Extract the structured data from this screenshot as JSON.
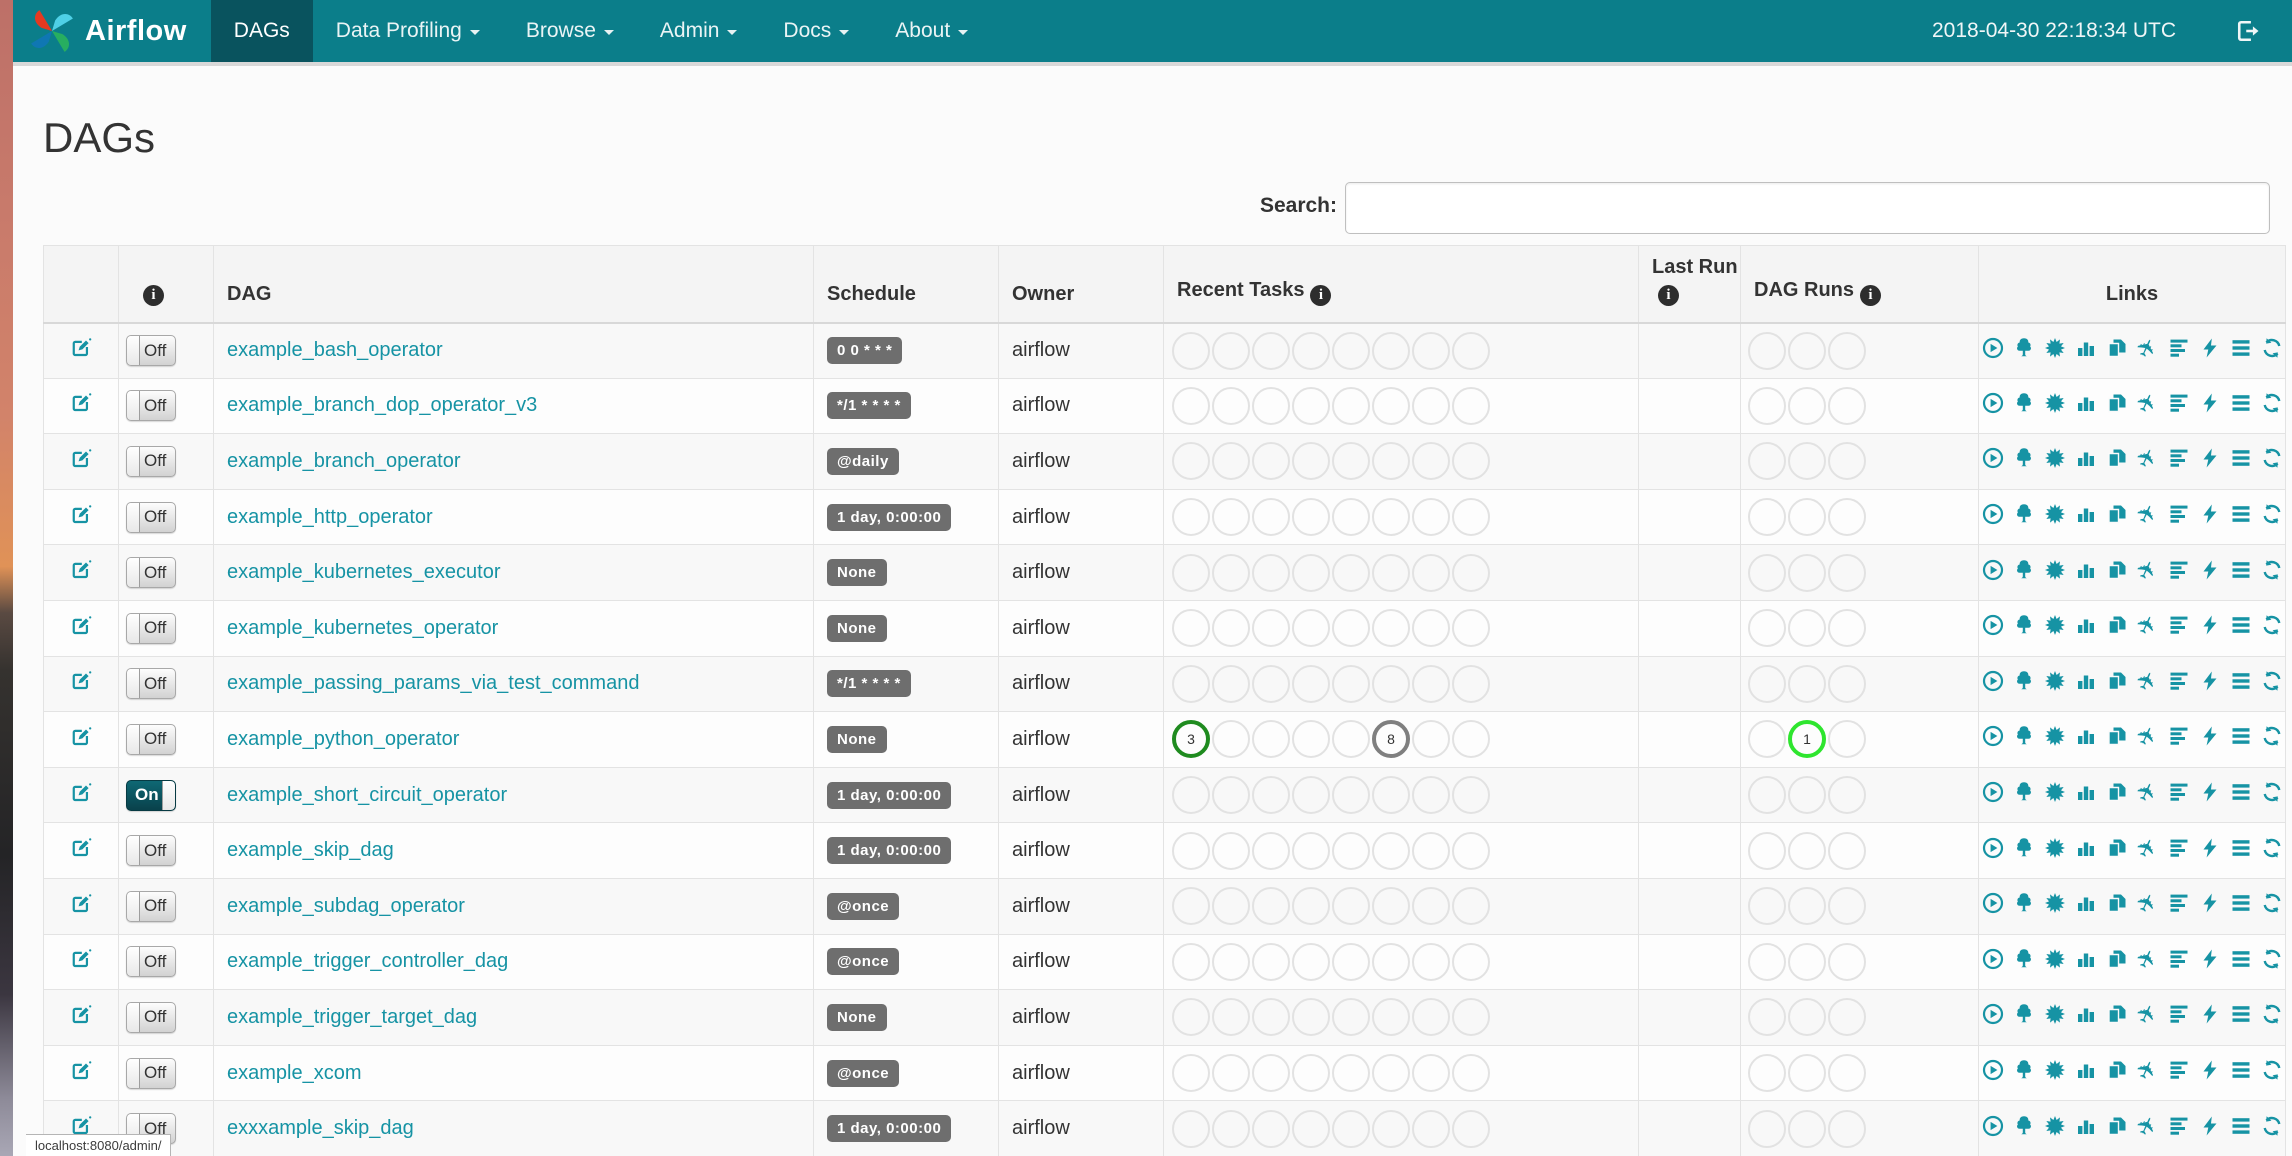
{
  "navbar": {
    "brand": "Airflow",
    "items": [
      {
        "label": "DAGs",
        "active": true,
        "caret": false
      },
      {
        "label": "Data Profiling",
        "active": false,
        "caret": true
      },
      {
        "label": "Browse",
        "active": false,
        "caret": true
      },
      {
        "label": "Admin",
        "active": false,
        "caret": true
      },
      {
        "label": "Docs",
        "active": false,
        "caret": true
      },
      {
        "label": "About",
        "active": false,
        "caret": true
      }
    ],
    "clock": "2018-04-30 22:18:34 UTC",
    "logout_icon": "sign-out-icon"
  },
  "page": {
    "title": "DAGs",
    "search_label": "Search:",
    "search_value": ""
  },
  "table": {
    "headers": {
      "edit": "",
      "info_icon": "info-icon",
      "dag": "DAG",
      "schedule": "Schedule",
      "owner": "Owner",
      "recent_tasks": "Recent Tasks",
      "last_run": "Last Run",
      "dag_runs": "DAG Runs",
      "links": "Links"
    },
    "recent_task_slots": 8,
    "dag_run_slots": 3,
    "links_icons": [
      "trigger-dag-icon",
      "tree-view-icon",
      "graph-view-icon",
      "task-duration-icon",
      "task-tries-icon",
      "landing-times-icon",
      "gantt-icon",
      "code-view-icon",
      "logs-icon",
      "refresh-icon"
    ],
    "rows": [
      {
        "name": "example_bash_operator",
        "toggle": "Off",
        "schedule": "0 0 * * *",
        "owner": "airflow",
        "recent_tasks": [],
        "dag_runs": []
      },
      {
        "name": "example_branch_dop_operator_v3",
        "toggle": "Off",
        "schedule": "*/1 * * * *",
        "owner": "airflow",
        "recent_tasks": [],
        "dag_runs": []
      },
      {
        "name": "example_branch_operator",
        "toggle": "Off",
        "schedule": "@daily",
        "owner": "airflow",
        "recent_tasks": [],
        "dag_runs": []
      },
      {
        "name": "example_http_operator",
        "toggle": "Off",
        "schedule": "1 day, 0:00:00",
        "owner": "airflow",
        "recent_tasks": [],
        "dag_runs": []
      },
      {
        "name": "example_kubernetes_executor",
        "toggle": "Off",
        "schedule": "None",
        "owner": "airflow",
        "recent_tasks": [],
        "dag_runs": []
      },
      {
        "name": "example_kubernetes_operator",
        "toggle": "Off",
        "schedule": "None",
        "owner": "airflow",
        "recent_tasks": [],
        "dag_runs": []
      },
      {
        "name": "example_passing_params_via_test_command",
        "toggle": "Off",
        "schedule": "*/1 * * * *",
        "owner": "airflow",
        "recent_tasks": [],
        "dag_runs": []
      },
      {
        "name": "example_python_operator",
        "toggle": "Off",
        "schedule": "None",
        "owner": "airflow",
        "recent_tasks": [
          {
            "slot": 1,
            "count": 3,
            "state": "success"
          },
          {
            "slot": 6,
            "count": 8,
            "state": "queued"
          }
        ],
        "dag_runs": [
          {
            "slot": 2,
            "count": 1,
            "state": "running"
          }
        ]
      },
      {
        "name": "example_short_circuit_operator",
        "toggle": "On",
        "schedule": "1 day, 0:00:00",
        "owner": "airflow",
        "recent_tasks": [],
        "dag_runs": []
      },
      {
        "name": "example_skip_dag",
        "toggle": "Off",
        "schedule": "1 day, 0:00:00",
        "owner": "airflow",
        "recent_tasks": [],
        "dag_runs": []
      },
      {
        "name": "example_subdag_operator",
        "toggle": "Off",
        "schedule": "@once",
        "owner": "airflow",
        "recent_tasks": [],
        "dag_runs": []
      },
      {
        "name": "example_trigger_controller_dag",
        "toggle": "Off",
        "schedule": "@once",
        "owner": "airflow",
        "recent_tasks": [],
        "dag_runs": []
      },
      {
        "name": "example_trigger_target_dag",
        "toggle": "Off",
        "schedule": "None",
        "owner": "airflow",
        "recent_tasks": [],
        "dag_runs": []
      },
      {
        "name": "example_xcom",
        "toggle": "Off",
        "schedule": "@once",
        "owner": "airflow",
        "recent_tasks": [],
        "dag_runs": []
      },
      {
        "name": "exxxample_skip_dag",
        "toggle": "Off",
        "schedule": "1 day, 0:00:00",
        "owner": "airflow",
        "recent_tasks": [],
        "dag_runs": []
      }
    ]
  },
  "browser": {
    "status_text": "localhost:8080/admin/"
  },
  "colors": {
    "navbar_bg": "#0b7e8a",
    "navbar_active": "#09535e",
    "accent": "#1693a4",
    "badge_bg": "#6e6e6e",
    "empty_circle": "#e2e2e2",
    "state_success": "#1f8b1f",
    "state_running": "#2ee52e",
    "state_queued": "#7f7f7f"
  }
}
